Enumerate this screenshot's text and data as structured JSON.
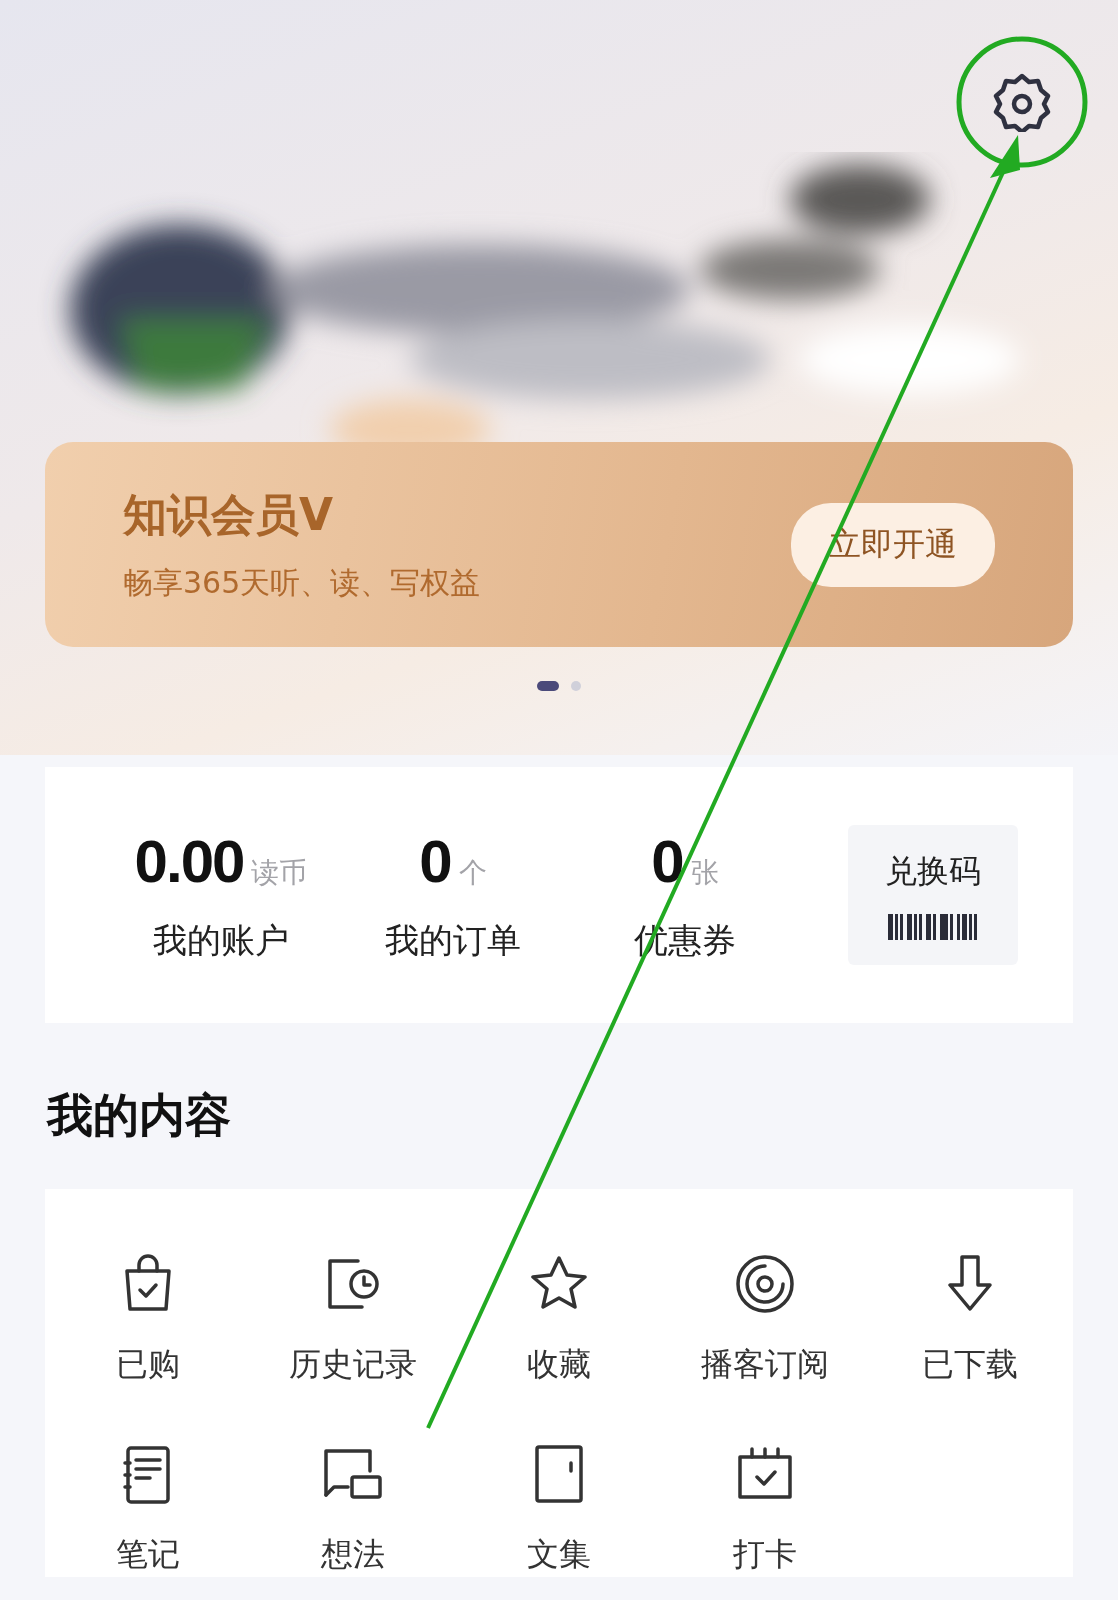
{
  "membership": {
    "title": "知识会员V",
    "subtitle": "畅享365天听、读、写权益",
    "button": "立即开通"
  },
  "carousel_dots": [
    {
      "selected": true
    },
    {
      "selected": false
    }
  ],
  "stats": [
    {
      "value": "0.00",
      "unit": "读币",
      "label": "我的账户"
    },
    {
      "value": "0",
      "unit": "个",
      "label": "我的订单"
    },
    {
      "value": "0",
      "unit": "张",
      "label": "优惠券"
    }
  ],
  "redeem": {
    "label": "兑换码"
  },
  "section_title": "我的内容",
  "content_items": [
    {
      "kind": "bag",
      "label": "已购"
    },
    {
      "kind": "history",
      "label": "历史记录"
    },
    {
      "kind": "star",
      "label": "收藏"
    },
    {
      "kind": "disc",
      "label": "播客订阅"
    },
    {
      "kind": "download",
      "label": "已下载"
    },
    {
      "kind": "notebook",
      "label": "笔记"
    },
    {
      "kind": "chat",
      "label": "想法"
    },
    {
      "kind": "book",
      "label": "文集"
    },
    {
      "kind": "calendar",
      "label": "打卡"
    }
  ]
}
